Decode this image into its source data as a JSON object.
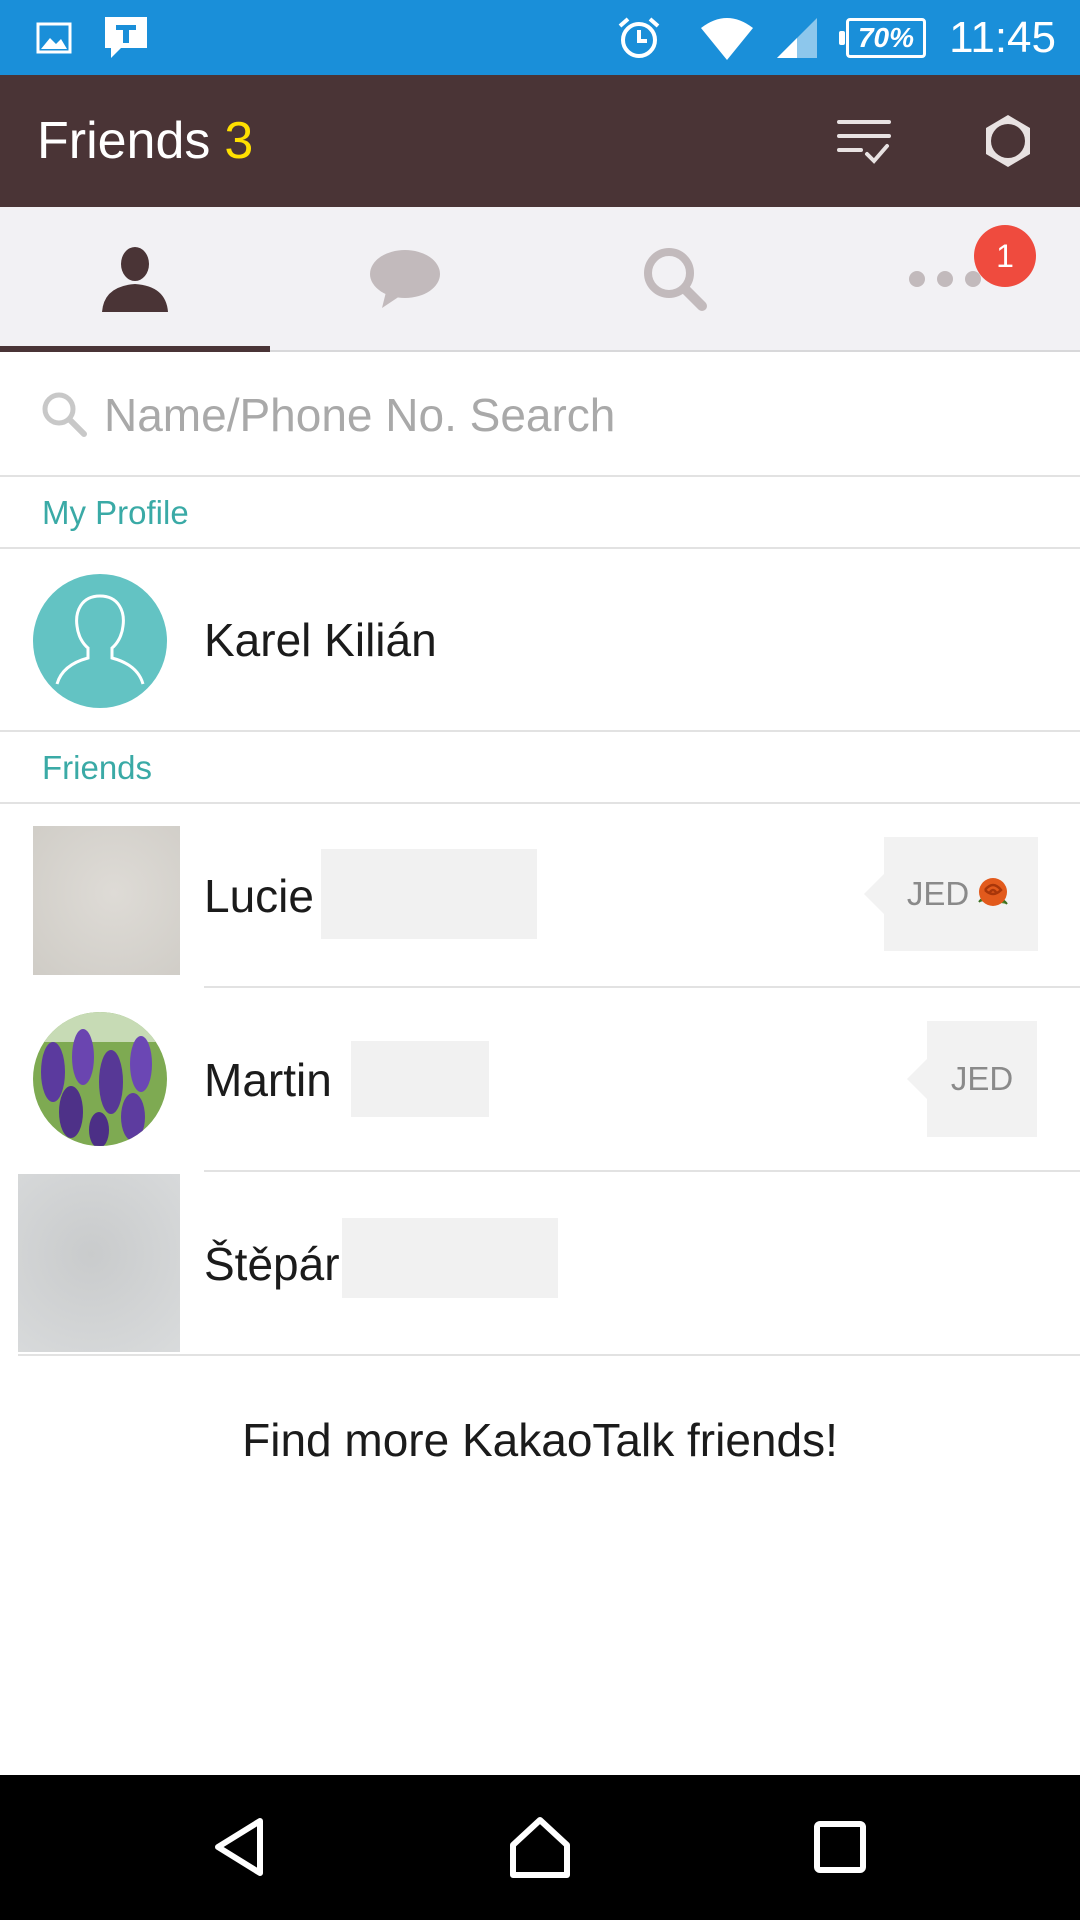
{
  "status_bar": {
    "time": "11:45",
    "battery": "70%",
    "icons": [
      "image-icon",
      "talk-t-icon",
      "alarm-icon",
      "wifi-icon",
      "signal-icon",
      "battery-icon"
    ]
  },
  "app_bar": {
    "title": "Friends",
    "count": "3",
    "actions": [
      "edit-list-icon",
      "settings-gear-icon"
    ]
  },
  "tabs": {
    "items": [
      {
        "name": "friends",
        "icon": "person-icon",
        "active": true
      },
      {
        "name": "chats",
        "icon": "chat-bubble-icon",
        "active": false
      },
      {
        "name": "find",
        "icon": "magnifier-icon",
        "active": false
      },
      {
        "name": "more",
        "icon": "more-dots-icon",
        "active": false
      }
    ],
    "more_badge": "1"
  },
  "search": {
    "placeholder": "Name/Phone No. Search"
  },
  "my_profile": {
    "header": "My Profile",
    "name": "Karel Kilián"
  },
  "friends": {
    "header": "Friends",
    "list": [
      {
        "name": "Lucie",
        "status": "JED",
        "status_has_rose": true
      },
      {
        "name": "Martin",
        "status": "JED",
        "status_has_rose": false
      },
      {
        "name": "Štěpár",
        "status": "",
        "status_has_rose": false
      }
    ]
  },
  "find_more": "Find more KakaoTalk friends!",
  "colors": {
    "status_bar": "#1a8fd9",
    "app_bar": "#4a3436",
    "count_accent": "#ffe000",
    "section_label": "#3aaaa6",
    "badge": "#ef4b3e",
    "avatar_teal": "#63c3c3"
  }
}
